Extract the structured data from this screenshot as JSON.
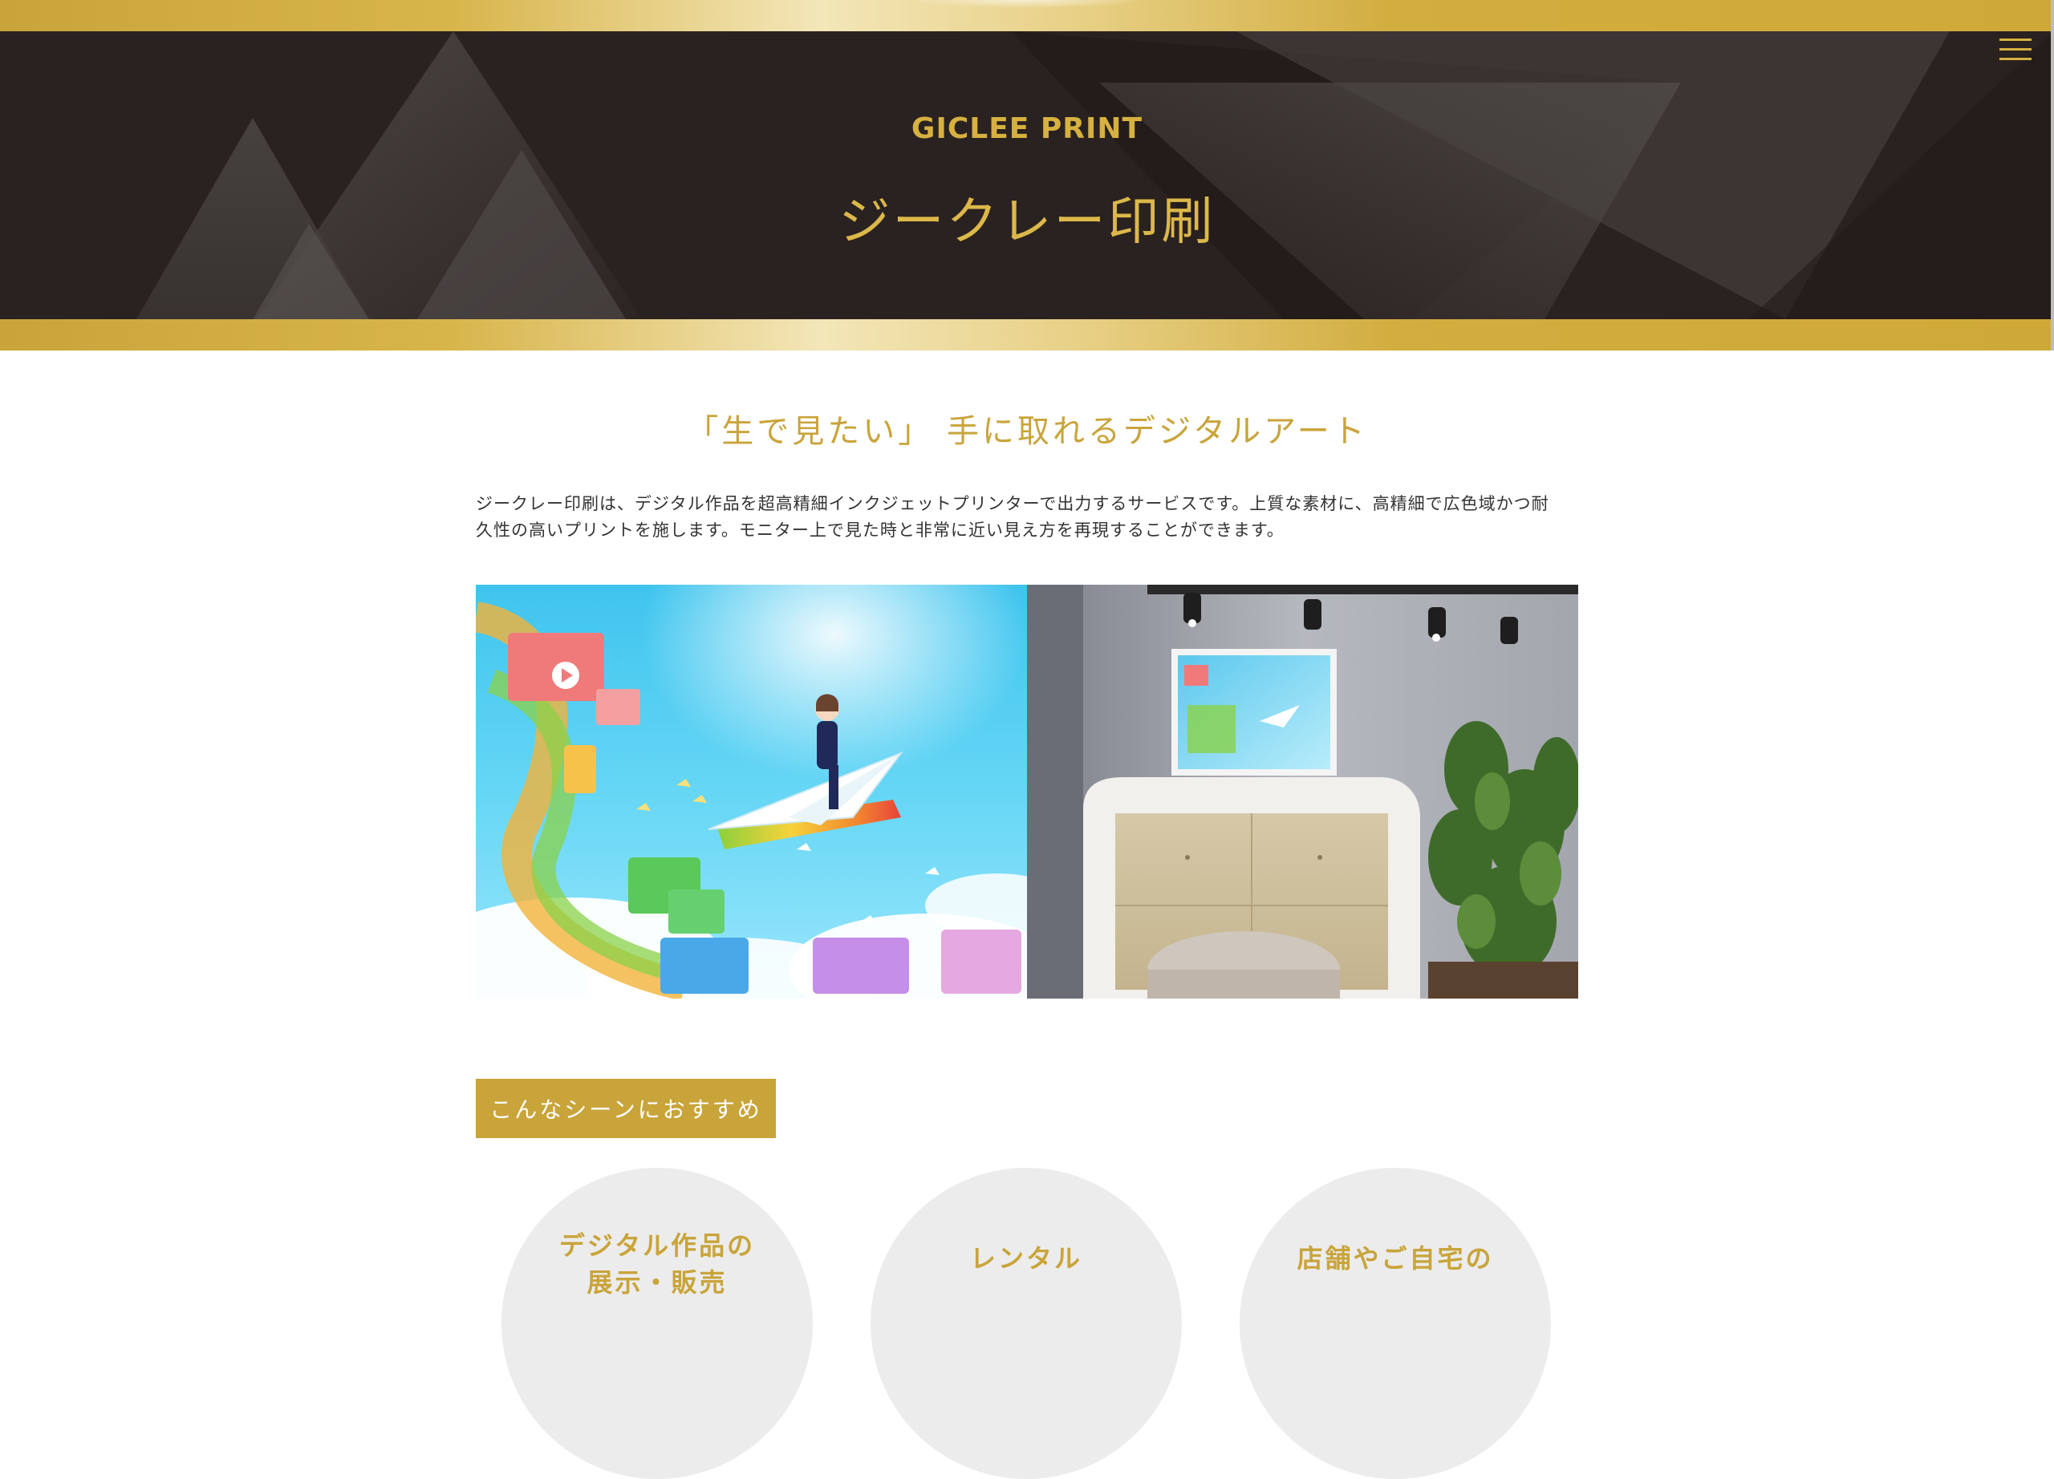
{
  "header": {
    "subtitle": "GICLEE PRINT",
    "title": "ジークレー印刷",
    "menu_icon": "hamburger-menu-icon"
  },
  "intro": {
    "heading": "「生で見たい」 手に取れるデジタルアート",
    "paragraph_line1": "ジークレー印刷は、デジタル作品を超高精細インクジェットプリンターで出力するサービスです。上質な素材に、高精細で広色域かつ耐",
    "paragraph_line2": "久性の高いプリントを施します。モニター上で見た時と非常に近い見え方を再現することができます。"
  },
  "scenes": {
    "tag_label": "こんなシーンにおすすめ",
    "items": [
      {
        "label_line1": "デジタル作品の",
        "label_line2": "展示・販売"
      },
      {
        "label_line1": "レンタル",
        "label_line2": ""
      },
      {
        "label_line1": "店舗やご自宅の",
        "label_line2": ""
      }
    ]
  },
  "colors": {
    "gold": "#c9a43a",
    "dark_banner": "#2a2220",
    "circle_bg": "#ececec",
    "body_text": "#333333"
  }
}
